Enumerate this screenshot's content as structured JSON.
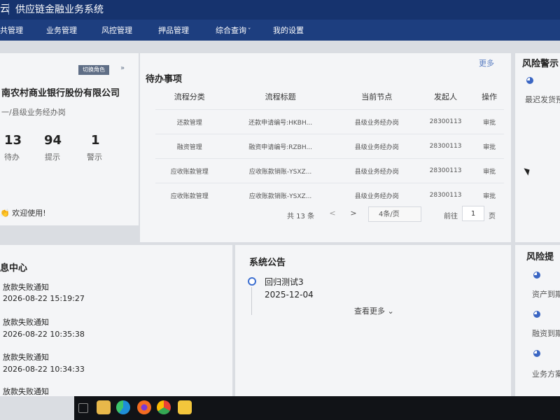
{
  "app": {
    "logo": "云",
    "title": "供应链金融业务系统"
  },
  "nav": [
    "共管理",
    "业务管理",
    "风控管理",
    "押品管理",
    "综合查询",
    "我的设置"
  ],
  "profile": {
    "switch_role": "切换角色",
    "bank": "南农村商业银行股份有限公司",
    "role": "一/县级业务经办岗",
    "stats": [
      {
        "value": "13",
        "label": "待办"
      },
      {
        "value": "94",
        "label": "提示"
      },
      {
        "value": "1",
        "label": "警示"
      }
    ],
    "welcome": "欢迎使用!"
  },
  "todo": {
    "title": "待办事项",
    "more": "更多",
    "columns": [
      "流程分类",
      "流程标题",
      "当前节点",
      "发起人",
      "操作"
    ],
    "rows": [
      {
        "category": "还款管理",
        "title": "还款申请编号:HKBH...",
        "node": "县级业务经办岗",
        "initiator": "28300113",
        "action": "审批"
      },
      {
        "category": "融资管理",
        "title": "融资申请编号:RZBH...",
        "node": "县级业务经办岗",
        "initiator": "28300113",
        "action": "审批"
      },
      {
        "category": "应收账款管理",
        "title": "应收账款销账-YSXZ...",
        "node": "县级业务经办岗",
        "initiator": "28300113",
        "action": "审批"
      },
      {
        "category": "应收账款管理",
        "title": "应收账款销账-YSXZ...",
        "node": "县级业务经办岗",
        "initiator": "28300113",
        "action": "审批"
      }
    ],
    "pagination": {
      "total": "共 13 条",
      "prev": "<",
      "next": ">",
      "page_size": "4条/页",
      "goto": "前往",
      "page": "1",
      "page_suffix": "页"
    }
  },
  "messages": {
    "title": "息中心",
    "items": [
      {
        "title": "放款失败通知",
        "time": "2026-08-22 15:19:27"
      },
      {
        "title": "放款失败通知",
        "time": "2026-08-22 10:35:38"
      },
      {
        "title": "放款失败通知",
        "time": "2026-08-22 10:34:33"
      },
      {
        "title": "放款失败通知",
        "time": ""
      }
    ]
  },
  "announcement": {
    "title": "系统公告",
    "item_title": "回归测试3",
    "item_date": "2025-12-04",
    "see_more": "查看更多"
  },
  "risk_warning": {
    "title": "风险警示",
    "items": [
      "最迟发货预"
    ]
  },
  "risk_tips": {
    "title": "风险提",
    "items": [
      "资产到期",
      "融资到期",
      "业务方案"
    ]
  },
  "colors": {
    "topbar": "#16336e",
    "navbar": "#1d3e7f",
    "link": "#4d7ed0",
    "pie": "#3b66c3"
  }
}
